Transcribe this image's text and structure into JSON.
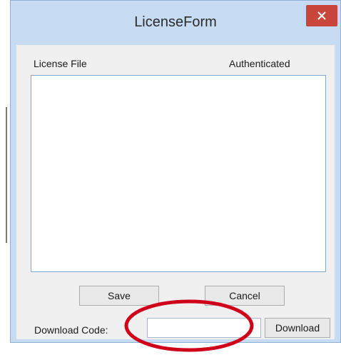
{
  "window": {
    "title": "LicenseForm"
  },
  "list": {
    "columns": [
      "License File",
      "Authenticated"
    ],
    "rows": []
  },
  "buttons": {
    "save_label": "Save",
    "cancel_label": "Cancel",
    "download_label": "Download"
  },
  "download_code": {
    "label": "Download Code:",
    "value": ""
  },
  "icons": {
    "close": "close-icon"
  },
  "colors": {
    "frame": "#c7dcf2",
    "close_button": "#c9463d",
    "annotation": "#d0021b"
  }
}
